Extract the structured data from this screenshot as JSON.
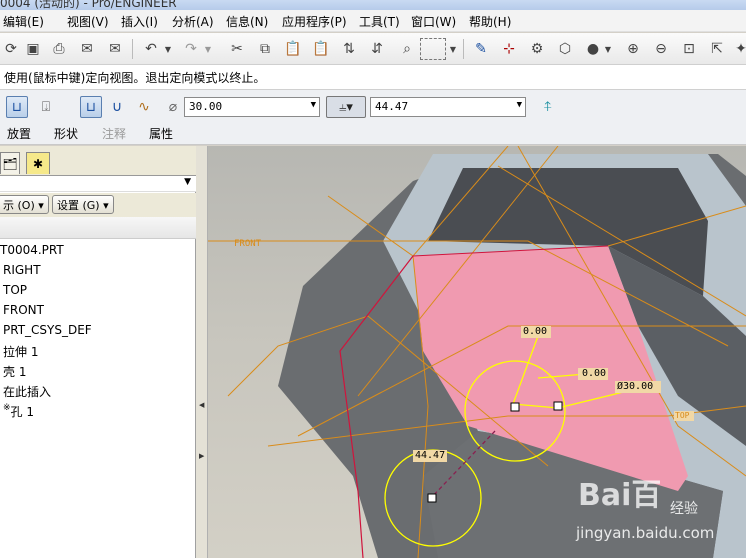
{
  "window": {
    "title": "0004 (活动的) - Pro/ENGINEER"
  },
  "menu": [
    "编辑(E)",
    "视图(V)",
    "插入(I)",
    "分析(A)",
    "信息(N)",
    "应用程序(P)",
    "工具(T)",
    "窗口(W)",
    "帮助(H)"
  ],
  "status_message": "使用(鼠标中键)定向视图。退出定向模式以终止。",
  "dashboard": {
    "diameter": "30.00",
    "depth": "44.47",
    "tabs": [
      "放置",
      "形状",
      "注释",
      "属性"
    ]
  },
  "model_tree": {
    "settings_label": "设置 (G)",
    "show_label": "示 (O)",
    "items": [
      "T0004.PRT",
      "RIGHT",
      "TOP",
      "FRONT",
      "PRT_CSYS_DEF",
      "拉伸 1",
      "壳 1",
      "在此插入",
      "孔 1"
    ]
  },
  "viewport": {
    "datum_front": "FRONT",
    "datum_top": "TOP",
    "dims": [
      "0.00",
      "0.00",
      "Ø30.00",
      "44.47"
    ]
  },
  "watermark": {
    "logo": "Bai百",
    "text": "经验",
    "url": "jingyan.baidu.com"
  },
  "colors": {
    "accent": "#1a4fa0",
    "sketch": "#ffff00",
    "datum": "#d98c1a",
    "highlight": "#f09ab0"
  }
}
